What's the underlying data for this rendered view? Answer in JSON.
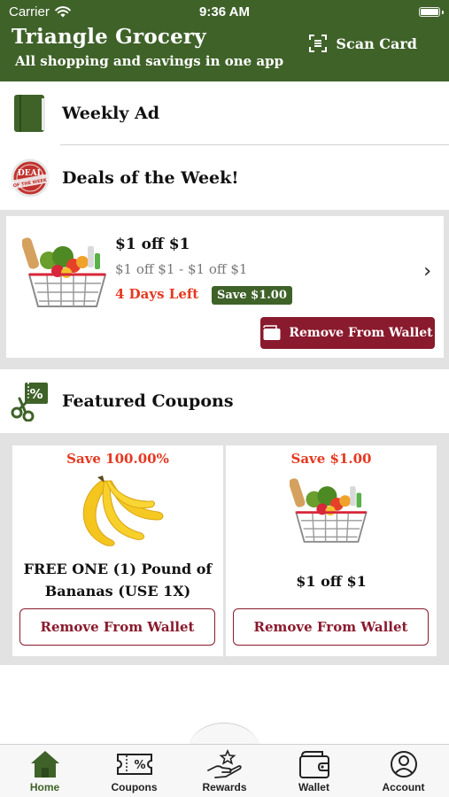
{
  "status_bar": {
    "carrier": "Carrier",
    "time": "9:36 AM"
  },
  "header": {
    "title": "Triangle Grocery",
    "subtitle": "All shopping and savings in one app",
    "scan_card_label": "Scan Card",
    "background_color": "#3f6229"
  },
  "sections": {
    "weekly_ad": {
      "label": "Weekly Ad",
      "icon": "book-icon"
    },
    "deals_of_week": {
      "label": "Deals of the Week!",
      "icon": "deal-of-the-week-badge-icon",
      "badge_text_top": "DEAL",
      "badge_text_bottom": "OF THE WEEK"
    },
    "featured_coupons": {
      "label": "Featured Coupons",
      "icon": "coupon-scissors-icon"
    }
  },
  "deal": {
    "title": "$1 off $1",
    "detail": "$1 off $1 - $1 off $1",
    "days_left": "4 Days Left",
    "save_badge": "Save $1.00",
    "image": "grocery-basket-image",
    "action_label": "Remove From Wallet"
  },
  "coupons": [
    {
      "save": "Save 100.00%",
      "image": "bananas-image",
      "title": "FREE ONE (1) Pound of Bananas (USE 1X)",
      "action_label": "Remove From Wallet"
    },
    {
      "save": "Save $1.00",
      "image": "grocery-basket-image",
      "title": "$1 off $1",
      "action_label": "Remove From Wallet"
    }
  ],
  "tabbar": {
    "active": "Home",
    "tabs": [
      {
        "label": "Home",
        "icon": "home-icon"
      },
      {
        "label": "Coupons",
        "icon": "coupon-ticket-icon"
      },
      {
        "label": "Rewards",
        "icon": "rewards-hand-star-icon"
      },
      {
        "label": "Wallet",
        "icon": "wallet-icon"
      },
      {
        "label": "Account",
        "icon": "account-user-icon"
      }
    ]
  },
  "colors": {
    "brand_green": "#3f6229",
    "accent_maroon": "#8a1a2d",
    "alert_red": "#e53820"
  }
}
